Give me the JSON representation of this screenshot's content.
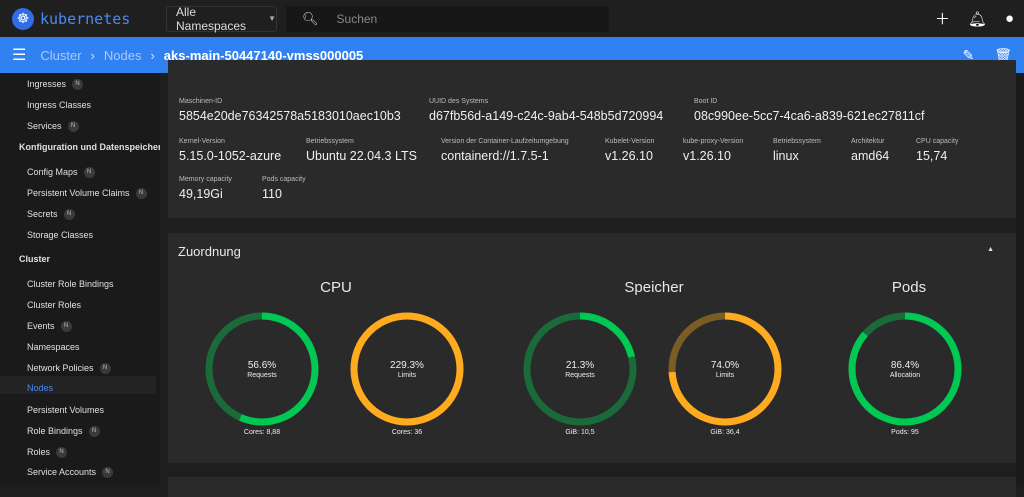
{
  "topbar": {
    "brand": "kubernetes",
    "namespace": "Alle Namespaces",
    "search_placeholder": "Suchen"
  },
  "breadcrumb": {
    "items": [
      "Cluster",
      "Nodes"
    ],
    "current": "aks-main-50447140-vmss000005"
  },
  "sidebar": {
    "items": [
      {
        "label": "Ingresses",
        "badge": "N"
      },
      {
        "label": "Ingress Classes"
      },
      {
        "label": "Services",
        "badge": "N"
      },
      {
        "label": "Konfiguration und Datenspeicherung",
        "header": true
      },
      {
        "label": "Config Maps",
        "badge": "N"
      },
      {
        "label": "Persistent Volume Claims",
        "badge": "N"
      },
      {
        "label": "Secrets",
        "badge": "N"
      },
      {
        "label": "Storage Classes"
      },
      {
        "label": "Cluster",
        "header": true
      },
      {
        "label": "Cluster Role Bindings"
      },
      {
        "label": "Cluster Roles"
      },
      {
        "label": "Events",
        "badge": "N"
      },
      {
        "label": "Namespaces"
      },
      {
        "label": "Network Policies",
        "badge": "N"
      },
      {
        "label": "Nodes",
        "active": true
      },
      {
        "label": "Persistent Volumes"
      },
      {
        "label": "Role Bindings",
        "badge": "N"
      },
      {
        "label": "Roles",
        "badge": "N"
      },
      {
        "label": "Service Accounts",
        "badge": "N"
      }
    ]
  },
  "system_info": {
    "fields": [
      {
        "label": "Maschinen-ID",
        "value": "5854e20de76342578a5183010aec10b3"
      },
      {
        "label": "UUID des Systems",
        "value": "d67fb56d-a149-c24c-9ab4-548b5d720994"
      },
      {
        "label": "Boot ID",
        "value": "08c990ee-5cc7-4ca6-a839-621ec27811cf"
      },
      {
        "label": "Kernel-Version",
        "value": "5.15.0-1052-azure"
      },
      {
        "label": "Betriebssystem",
        "value": "Ubuntu 22.04.3 LTS"
      },
      {
        "label": "Version der Container-Laufzeitumgebung",
        "value": "containerd://1.7.5-1"
      },
      {
        "label": "Kubelet-Version",
        "value": "v1.26.10"
      },
      {
        "label": "kube-proxy-Version",
        "value": "v1.26.10"
      },
      {
        "label": "Betriebssystem",
        "value": "linux"
      },
      {
        "label": "Architektur",
        "value": "amd64"
      },
      {
        "label": "CPU capacity",
        "value": "15,74"
      },
      {
        "label": "Memory capacity",
        "value": "49,19Gi"
      },
      {
        "label": "Pods capacity",
        "value": "110"
      }
    ]
  },
  "allocation": {
    "title": "Zuordnung",
    "groups": [
      {
        "title": "CPU"
      },
      {
        "title": "Speicher"
      },
      {
        "title": "Pods"
      }
    ],
    "gauges": [
      {
        "percent": 56.6,
        "pct_label": "56.6%",
        "sub": "Requests",
        "foot": "Cores: 8,88",
        "color": "#00c853",
        "track": "#1b6b3a"
      },
      {
        "percent": 229.3,
        "pct_label": "229.3%",
        "sub": "Limits",
        "foot": "Cores: 36",
        "color": "#ffab1f",
        "track": "#6e5523"
      },
      {
        "percent": 21.3,
        "pct_label": "21.3%",
        "sub": "Requests",
        "foot": "GiB: 10,5",
        "color": "#00c853",
        "track": "#1b6b3a"
      },
      {
        "percent": 74.0,
        "pct_label": "74.0%",
        "sub": "Limits",
        "foot": "GiB: 36,4",
        "color": "#ffab1f",
        "track": "#7a5c25"
      },
      {
        "percent": 86.4,
        "pct_label": "86.4%",
        "sub": "Allocation",
        "foot": "Pods: 95",
        "color": "#00c853",
        "track": "#1b6b3a"
      }
    ]
  }
}
